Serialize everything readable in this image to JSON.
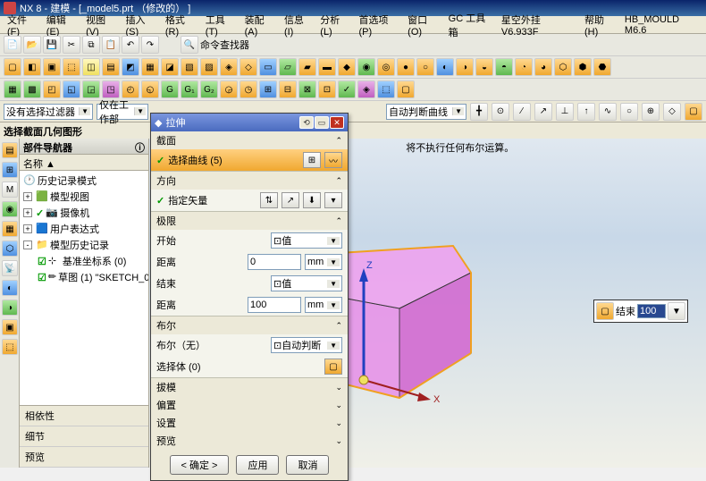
{
  "title": "NX 8 - 建模 - [_model5.prt （修改的） ]",
  "menu": [
    "文件(F)",
    "编辑(E)",
    "视图(V)",
    "插入(S)",
    "格式(R)",
    "工具(T)",
    "装配(A)",
    "信息(I)",
    "分析(L)",
    "首选项(P)",
    "窗口(O)",
    "GC 工具箱",
    "星空外挂 V6.933F",
    "帮助(H)",
    "HB_MOULD M6.6"
  ],
  "cmd_finder": "命令查找器",
  "filters": {
    "f1": "没有选择过滤器",
    "f2": "仅在工作部",
    "f3": "自动判断曲线"
  },
  "sel_banner": "选择截面几何图形",
  "nav": {
    "title": "部件导航器",
    "col": "名称",
    "items": [
      {
        "icon": "clock",
        "label": "历史记录模式",
        "check": false,
        "ind": 0
      },
      {
        "icon": "cube",
        "label": "模型视图",
        "plus": "+",
        "ind": 0
      },
      {
        "icon": "cam",
        "label": "摄像机",
        "check": true,
        "plus": "+",
        "ind": 0
      },
      {
        "icon": "cube",
        "label": "用户表达式",
        "plus": "+",
        "ind": 0
      },
      {
        "icon": "folder",
        "label": "模型历史记录",
        "plus": "-",
        "ind": 0
      },
      {
        "icon": "csys",
        "label": "基准坐标系 (0)",
        "check2": true,
        "ind": 1
      },
      {
        "icon": "sketch",
        "label": "草图 (1) \"SKETCH_0",
        "check2": true,
        "ind": 1
      }
    ],
    "tabs": [
      "相依性",
      "细节",
      "预览"
    ]
  },
  "dialog": {
    "title": "拉伸",
    "section_curve": "截面",
    "select_curve": "选择曲线 (5)",
    "section_dir": "方向",
    "spec_vector": "指定矢量",
    "section_limits": "极限",
    "start": "开始",
    "start_opt": "值",
    "start_val": "0",
    "start_unit": "mm",
    "dist1": "距离",
    "end": "结束",
    "end_opt": "值",
    "end_val": "100",
    "end_unit": "mm",
    "dist2": "距离",
    "section_bool": "布尔",
    "bool_label": "布尔（无）",
    "bool_opt": "自动判断",
    "select_body": "选择体 (0)",
    "sec_draft": "拔模",
    "sec_offset": "偏置",
    "sec_settings": "设置",
    "sec_preview": "预览",
    "btn_ok": "< 确定 >",
    "btn_apply": "应用",
    "btn_cancel": "取消"
  },
  "canvas": {
    "msg": "将不执行任何布尔运算。"
  },
  "floatbox": {
    "label": "结束",
    "value": "100"
  }
}
